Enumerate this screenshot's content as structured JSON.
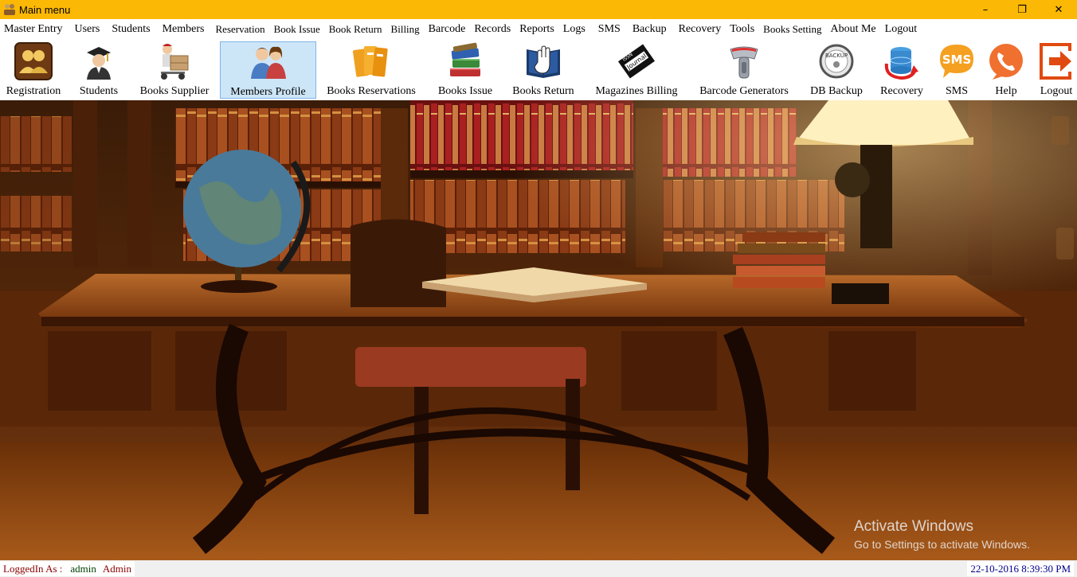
{
  "window": {
    "title": "Main menu",
    "controls": {
      "minimize": "–",
      "maximize": "❐",
      "close": "✕"
    }
  },
  "menu": [
    "Master Entry",
    "Users",
    "Students",
    "Members",
    "Reservation",
    "Book Issue",
    "Book Return",
    "Billing",
    "Barcode",
    "Records",
    "Reports",
    "Logs",
    "SMS",
    "Backup",
    "Recovery",
    "Tools",
    "Books Setting",
    "About Me",
    "Logout"
  ],
  "toolbar": {
    "registration": "Registration",
    "students": "Students",
    "books_supplier": "Books Supplier",
    "members_profile": "Members Profile",
    "books_reservations": "Books Reservations",
    "books_issue": "Books Issue",
    "books_return": "Books Return",
    "magazines_billing": "Magazines Billing",
    "barcode_generators": "Barcode Generators",
    "db_backup": "DB Backup",
    "recovery": "Recovery",
    "sms": "SMS",
    "help": "Help",
    "logout": "Logout",
    "backup_icon_text": "BACKUP",
    "sms_icon_text": "SMS",
    "journal_icon_text": "Journal",
    "issn_icon_text": "ISSN"
  },
  "watermark": {
    "line1": "Activate Windows",
    "line2": "Go to Settings to activate Windows."
  },
  "status": {
    "logged_in_label": "LoggedIn As :",
    "username": "admin",
    "role": "Admin",
    "datetime": "22-10-2016 8:39:30 PM"
  },
  "colors": {
    "titlebar": "#fbb804",
    "active_tool": "#cde6f7"
  }
}
